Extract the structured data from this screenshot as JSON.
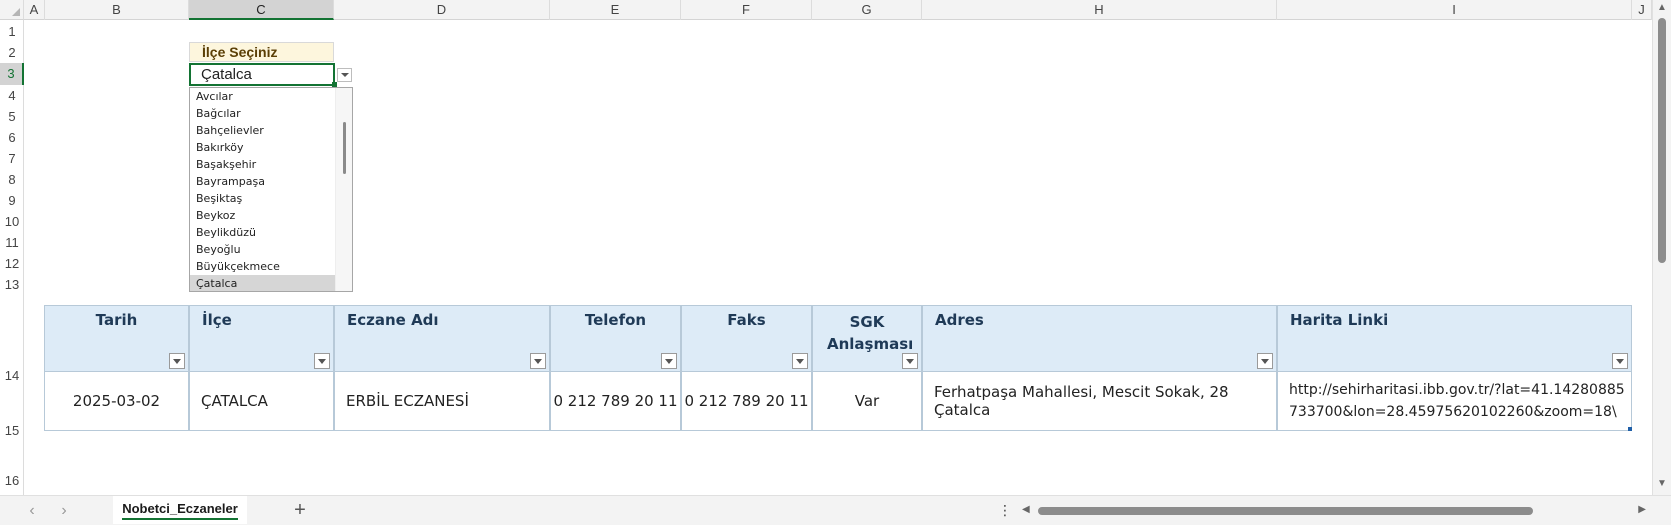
{
  "columns": [
    "A",
    "B",
    "C",
    "D",
    "E",
    "F",
    "G",
    "H",
    "I",
    "J"
  ],
  "rows": [
    "1",
    "2",
    "3",
    "4",
    "5",
    "6",
    "7",
    "8",
    "9",
    "10",
    "11",
    "12",
    "13",
    "14",
    "15",
    "16"
  ],
  "selector": {
    "title": "İlçe Seçiniz",
    "value": "Çatalca",
    "options": [
      "Avcılar",
      "Bağcılar",
      "Bahçelievler",
      "Bakırköy",
      "Başakşehir",
      "Bayrampaşa",
      "Beşiktaş",
      "Beykoz",
      "Beylikdüzü",
      "Beyoğlu",
      "Büyükçekmece",
      "Çatalca"
    ],
    "selected_index": 11
  },
  "table": {
    "headers": [
      "Tarih",
      "İlçe",
      "Eczane Adı",
      "Telefon",
      "Faks",
      "SGK Anlaşması",
      "Adres",
      "Harita Linki"
    ],
    "row": {
      "tarih": "2025-03-02",
      "ilce": "ÇATALCA",
      "eczane": "ERBİL ECZANESİ",
      "telefon": "0 212 789 20 11",
      "faks": "0 212 789 20 11",
      "sgk": "Var",
      "adres": "Ferhatpaşa Mahallesi, Mescit Sokak, 28 Çatalca",
      "link": "http://sehirharitasi.ibb.gov.tr/?lat=41.14280885733700&lon=28.45975620102260&zoom=18\\"
    }
  },
  "sheet_tab": "Nobetci_Eczaneler",
  "icons": {
    "prev": "chevron-left-icon",
    "next": "chevron-right-icon",
    "add": "plus-icon",
    "more": "vertical-ellipsis-icon"
  },
  "colors": {
    "header_fill": "#ddebf7",
    "selector_title_fill": "#fdf6dd",
    "selection_green": "#137333"
  }
}
